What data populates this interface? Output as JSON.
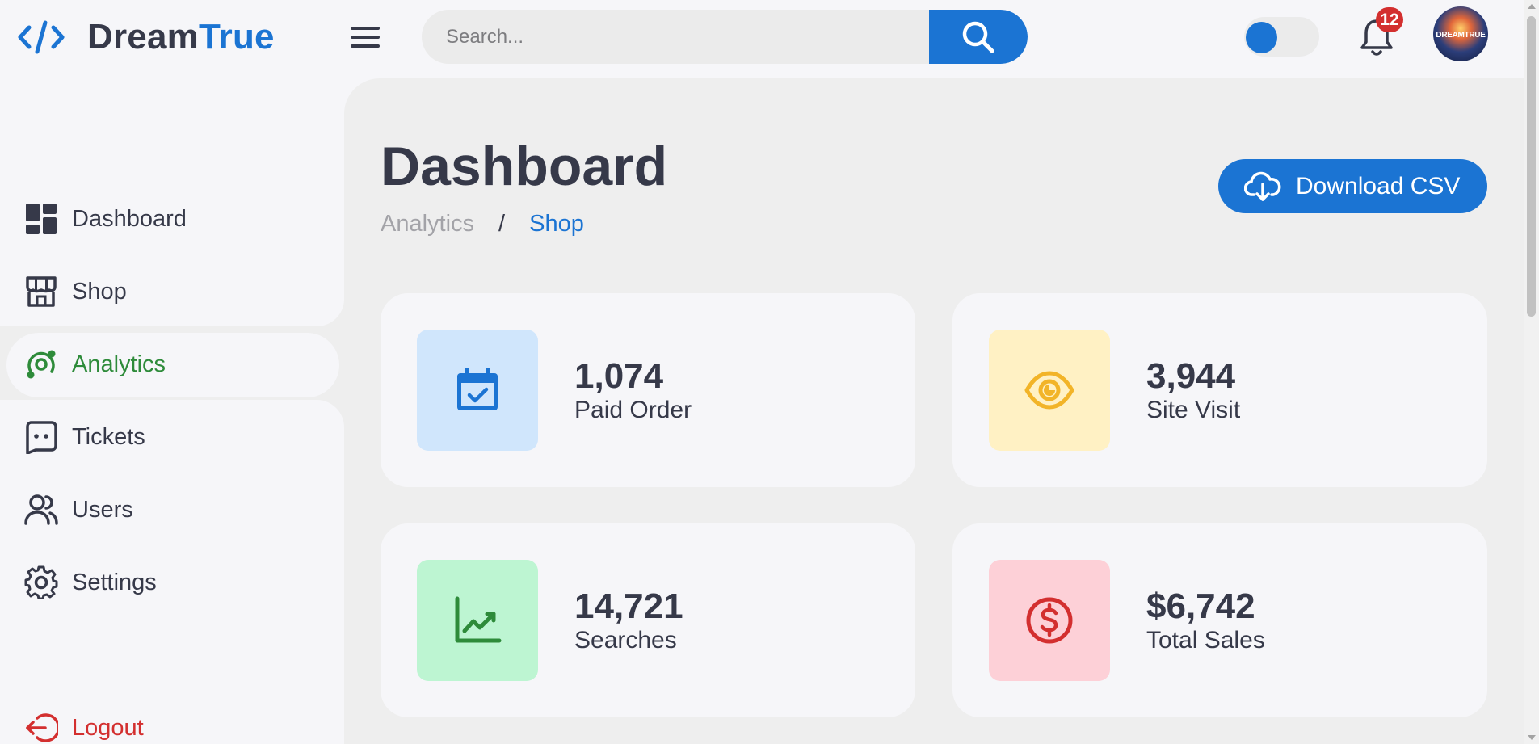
{
  "brand": {
    "name_part1": "Dream",
    "name_part2": "True"
  },
  "search": {
    "placeholder": "Search..."
  },
  "notifications": {
    "count": "12"
  },
  "avatar": {
    "text": "DREAMTRUE"
  },
  "theme_toggle": {
    "state": "on",
    "color": "#1b74d3"
  },
  "sidebar": {
    "items": [
      {
        "label": "Dashboard",
        "icon": "dashboard-icon"
      },
      {
        "label": "Shop",
        "icon": "shop-icon"
      },
      {
        "label": "Analytics",
        "icon": "analytics-icon",
        "active": true
      },
      {
        "label": "Tickets",
        "icon": "tickets-icon"
      },
      {
        "label": "Users",
        "icon": "users-icon"
      },
      {
        "label": "Settings",
        "icon": "gear-icon"
      }
    ],
    "logout": {
      "label": "Logout",
      "icon": "logout-icon"
    }
  },
  "main": {
    "title": "Dashboard",
    "breadcrumb": {
      "parent": "Analytics",
      "separator": "/",
      "current": "Shop"
    },
    "download_button": "Download CSV"
  },
  "stats": [
    {
      "value": "1,074",
      "label": "Paid Order",
      "icon": "calendar-check-icon",
      "bg": "#d0e6fc",
      "fg": "#1b74d3"
    },
    {
      "value": "3,944",
      "label": "Site Visit",
      "icon": "eye-icon",
      "bg": "#fff1c4",
      "fg": "#f2b428"
    },
    {
      "value": "14,721",
      "label": "Searches",
      "icon": "line-chart-icon",
      "bg": "#bdf5d2",
      "fg": "#2e8b3a"
    },
    {
      "value": "$6,742",
      "label": "Total Sales",
      "icon": "dollar-icon",
      "bg": "#fdd0d7",
      "fg": "#d32f2f"
    }
  ],
  "colors": {
    "primary": "#1b74d3",
    "success": "#2e8b3a",
    "danger": "#d32f2f",
    "text": "#363949"
  }
}
